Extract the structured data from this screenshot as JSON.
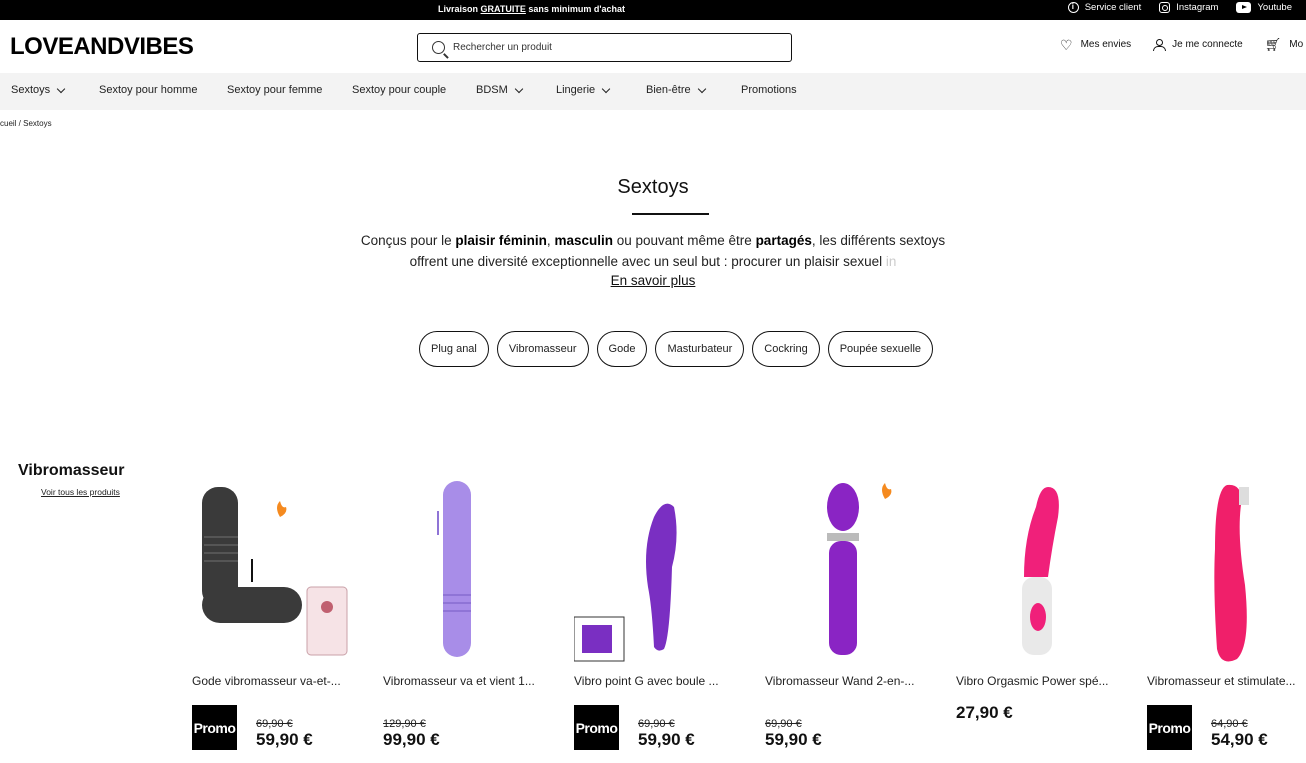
{
  "topbar": {
    "promo_prefix": "Livraison",
    "promo_highlight": "GRATUITE",
    "promo_suffix": "sans minimum d'achat",
    "links": [
      "Service client",
      "Instagram",
      "Youtube"
    ]
  },
  "header": {
    "logo": "LOVEANDVIBES",
    "search_placeholder": "Rechercher un produit",
    "wishlist": "Mes envies",
    "account": "Je me connecte",
    "cart": "Mo"
  },
  "nav": {
    "items": [
      {
        "label": "Sextoys",
        "has_dropdown": true
      },
      {
        "label": "Sextoy pour homme",
        "has_dropdown": false
      },
      {
        "label": "Sextoy pour femme",
        "has_dropdown": false
      },
      {
        "label": "Sextoy pour couple",
        "has_dropdown": false
      },
      {
        "label": "BDSM",
        "has_dropdown": true
      },
      {
        "label": "Lingerie",
        "has_dropdown": true
      },
      {
        "label": "Bien-être",
        "has_dropdown": true
      },
      {
        "label": "Promotions",
        "has_dropdown": false
      }
    ]
  },
  "breadcrumb": "ccueil / Sextoys",
  "hero": {
    "title": "Sextoys",
    "desc_1": "Conçus pour le ",
    "desc_b1": "plaisir féminin",
    "desc_2": ", ",
    "desc_b2": "masculin",
    "desc_3": " ou pouvant même être ",
    "desc_b3": "partagés",
    "desc_4": ", les différents sextoys",
    "desc_line2": "offrent une diversité exceptionnelle avec un seul but : procurer un plaisir sexuel ",
    "desc_fade": "in",
    "more_link": "En savoir plus"
  },
  "chips": [
    "Plug anal",
    "Vibromasseur",
    "Gode",
    "Masturbateur",
    "Cockring",
    "Poupée sexuelle"
  ],
  "section": {
    "title": "Vibromasseur",
    "link": "Voir tous les produits"
  },
  "products": [
    {
      "name": "Gode vibromasseur va-et-...",
      "promo": "Promo",
      "old_price": "69,90 €",
      "price": "59,90 €",
      "color": "#3a3a3a"
    },
    {
      "name": "Vibromasseur va et vient 1...",
      "promo": "",
      "old_price": "129,90 €",
      "price": "99,90 €",
      "color": "#a88de8"
    },
    {
      "name": "Vibro point G avec boule ...",
      "promo": "Promo",
      "old_price": "69,90 €",
      "price": "59,90 €",
      "color": "#7a2fc2"
    },
    {
      "name": "Vibromasseur Wand 2-en-...",
      "promo": "",
      "old_price": "69,90 €",
      "price": "59,90 €",
      "color": "#8a24c4"
    },
    {
      "name": "Vibro Orgasmic Power spé...",
      "promo": "",
      "old_price": "",
      "price": "27,90 €",
      "color": "#f0207a"
    },
    {
      "name": "Vibromasseur et stimulate...",
      "promo": "Promo",
      "old_price": "64,90 €",
      "price": "54,90 €",
      "color": "#f01f6a"
    }
  ]
}
